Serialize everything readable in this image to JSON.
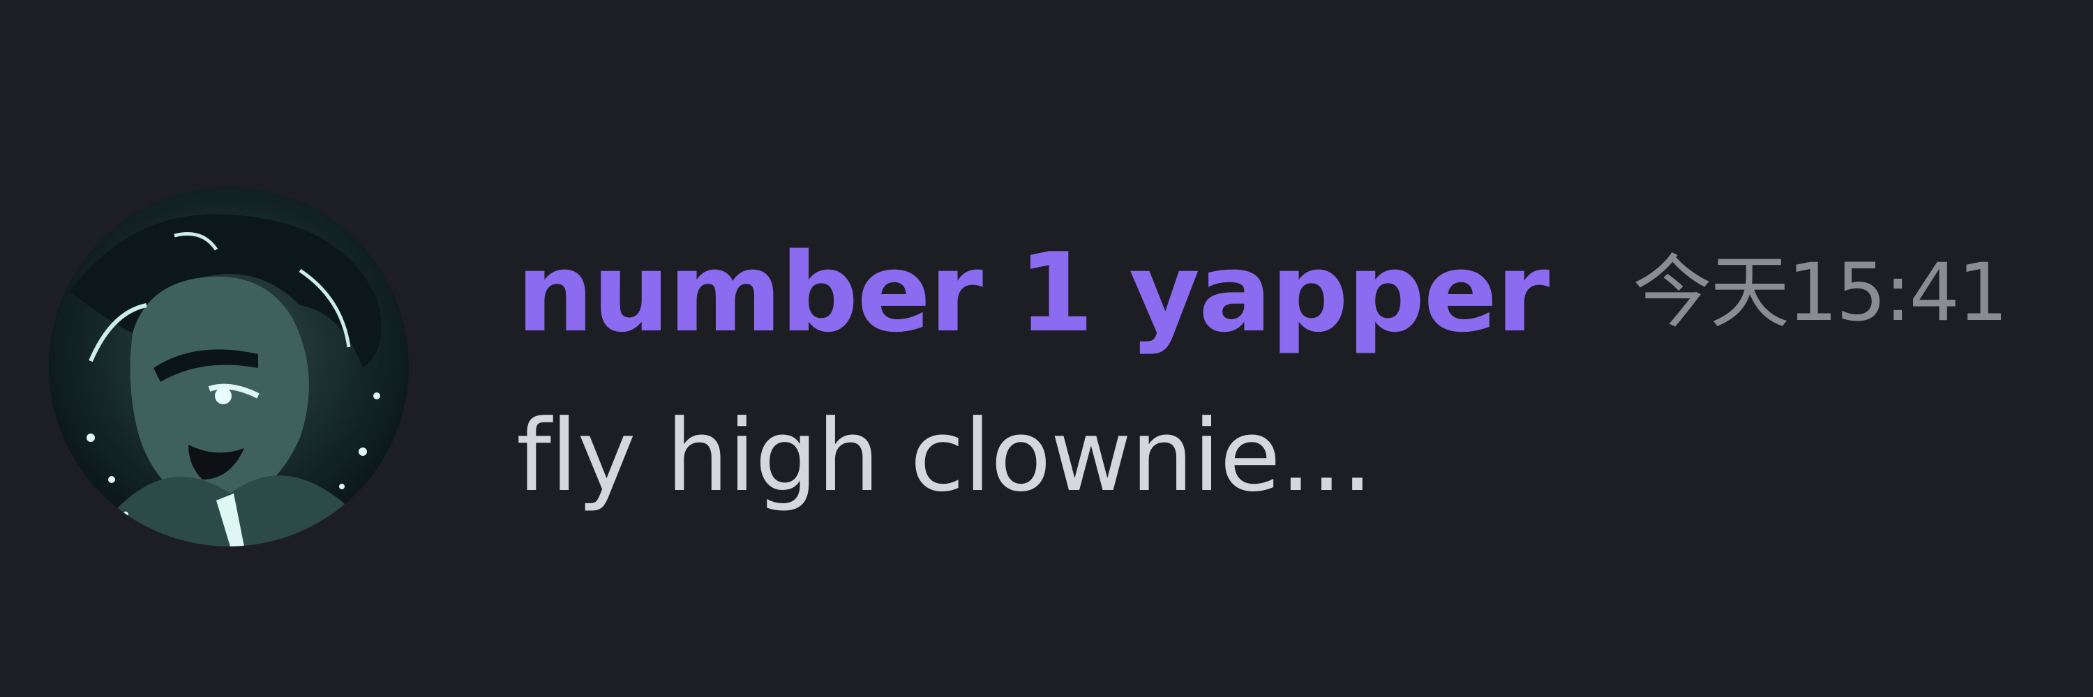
{
  "message": {
    "username": "number 1 yapper",
    "timestamp": "今天15:41",
    "content": "fly high clownie..."
  },
  "colors": {
    "background": "#1d1e24",
    "username": "#8b6cf0",
    "timestamp": "#8a8c93",
    "content": "#d6d7db"
  }
}
